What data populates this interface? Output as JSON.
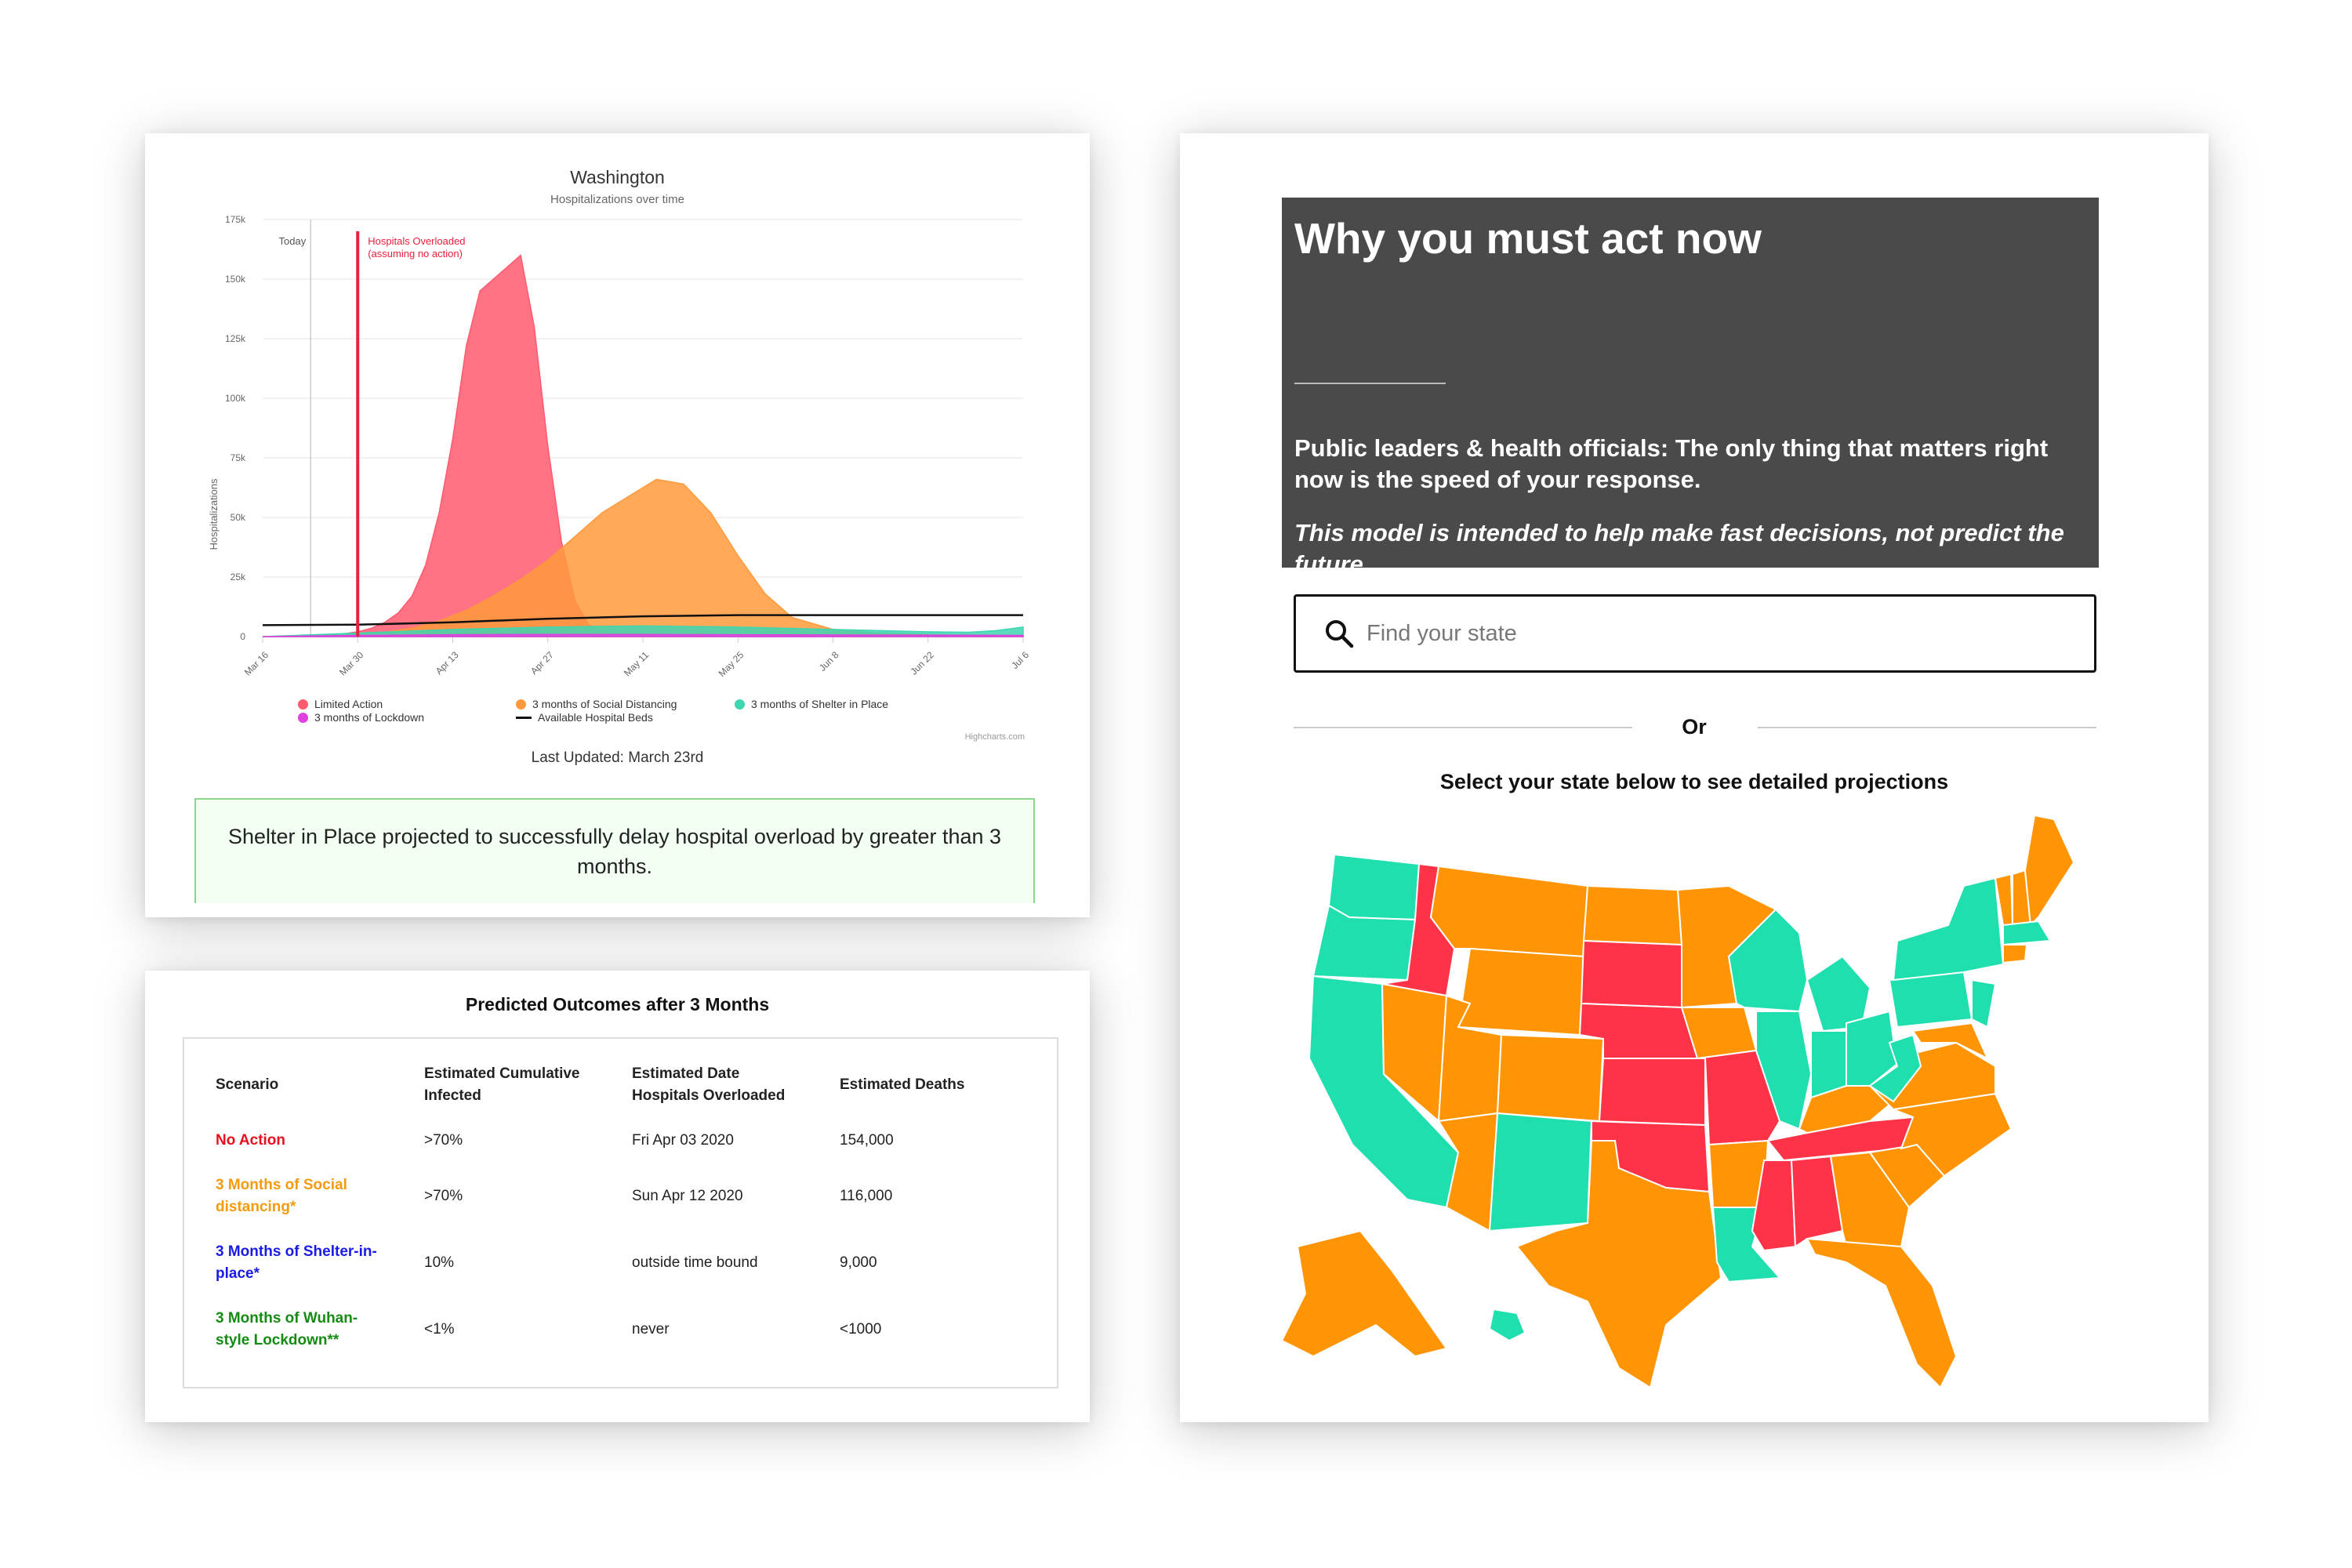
{
  "chart_panel": {
    "title": "Washington",
    "subtitle": "Hospitalizations over time",
    "today_label": "Today",
    "overload_label_1": "Hospitals Overloaded",
    "overload_label_2": "(assuming no action)",
    "credits": "Highcharts.com",
    "last_updated": "Last Updated: March 23rd",
    "notice": "Shelter in Place projected to successfully delay hospital overload by greater than 3 months."
  },
  "chart_data": {
    "type": "area",
    "title": "Washington",
    "subtitle": "Hospitalizations over time",
    "ylabel": "Hospitalizations",
    "ylim": [
      0,
      175000
    ],
    "ytick_labels": [
      "0",
      "25k",
      "50k",
      "75k",
      "100k",
      "125k",
      "150k",
      "175k"
    ],
    "xtick_labels": [
      "Mar 16",
      "Mar 30",
      "Apr 13",
      "Apr 27",
      "May 11",
      "May 25",
      "Jun 8",
      "Jun 22",
      "Jul 6"
    ],
    "x_days": [
      0,
      14,
      28,
      42,
      56,
      70,
      84,
      98,
      112
    ],
    "today_day": 14,
    "overload_day": 14,
    "legend_position": "bottom-left",
    "series": [
      {
        "name": "Limited Action",
        "color": "#ff5a6e",
        "x": [
          0,
          4,
          8,
          10,
          12,
          14,
          16,
          18,
          20,
          22,
          24,
          26,
          28,
          30,
          32,
          34,
          36,
          38,
          40,
          42,
          44,
          46,
          48,
          50,
          52,
          54,
          56,
          60,
          70,
          80,
          90,
          100,
          112
        ],
        "y": [
          0,
          200,
          500,
          800,
          1200,
          2000,
          3500,
          6000,
          10000,
          17000,
          30000,
          52000,
          83000,
          122000,
          145000,
          150000,
          155000,
          160000,
          130000,
          80000,
          40000,
          15000,
          5000,
          2000,
          1000,
          500,
          300,
          200,
          100,
          100,
          100,
          100,
          100
        ]
      },
      {
        "name": "3 months of Social Distancing",
        "color": "#ff9a3c",
        "x": [
          0,
          10,
          14,
          18,
          22,
          26,
          30,
          34,
          38,
          42,
          46,
          50,
          54,
          58,
          62,
          66,
          70,
          74,
          78,
          84,
          90,
          100,
          112
        ],
        "y": [
          0,
          300,
          800,
          1800,
          3500,
          6500,
          11000,
          17000,
          24000,
          32000,
          42000,
          52000,
          59000,
          66000,
          64000,
          52000,
          34000,
          18000,
          8000,
          3000,
          1500,
          800,
          500
        ]
      },
      {
        "name": "3 months of Shelter in Place",
        "color": "#3dd6b0",
        "x": [
          0,
          14,
          28,
          42,
          56,
          70,
          84,
          98,
          104,
          108,
          112
        ],
        "y": [
          0,
          1500,
          3000,
          4000,
          4500,
          4000,
          3000,
          2000,
          1800,
          2500,
          4000
        ]
      },
      {
        "name": "3 months of Lockdown",
        "color": "#e040e0",
        "x": [
          0,
          14,
          28,
          42,
          56,
          70,
          84,
          98,
          112
        ],
        "y": [
          0,
          500,
          800,
          900,
          900,
          800,
          700,
          600,
          500
        ]
      },
      {
        "name": "Available Hospital Beds",
        "color": "#111111",
        "line_only": true,
        "x": [
          0,
          14,
          28,
          42,
          56,
          70,
          84,
          98,
          112
        ],
        "y": [
          4800,
          5000,
          6000,
          7500,
          8500,
          9000,
          9000,
          9000,
          9000
        ]
      }
    ]
  },
  "table_panel": {
    "title": "Predicted Outcomes after 3 Months",
    "headers": {
      "scenario": "Scenario",
      "infected_1": "Estimated Cumulative",
      "infected_2": "Infected",
      "overload_1": "Estimated Date",
      "overload_2": "Hospitals Overloaded",
      "deaths": "Estimated Deaths"
    },
    "rows": [
      {
        "scenario_1": "No Action",
        "scenario_2": "",
        "color": "#e8101e",
        "infected": ">70%",
        "overload": "Fri Apr 03 2020",
        "deaths": "154,000"
      },
      {
        "scenario_1": "3 Months of Social",
        "scenario_2": "distancing*",
        "color": "#f39a0e",
        "infected": ">70%",
        "overload": "Sun Apr 12 2020",
        "deaths": "116,000"
      },
      {
        "scenario_1": "3 Months of Shelter-in-",
        "scenario_2": "place*",
        "color": "#1a1ae6",
        "infected": "10%",
        "overload": "outside time bound",
        "deaths": "9,000"
      },
      {
        "scenario_1": "3 Months of Wuhan-",
        "scenario_2": "style Lockdown**",
        "color": "#148c14",
        "infected": "<1%",
        "overload": "never",
        "deaths": "<1000"
      }
    ]
  },
  "right_panel": {
    "heading": "Why you must act now",
    "para1": "Public leaders & health officials: The only thing that matters right now is the speed of your response.",
    "para2": "This model is intended to help make fast decisions, not predict the future.",
    "search_placeholder": "Find your state",
    "or_label": "Or",
    "select_prompt": "Select your state below to see detailed projections",
    "map_colors": {
      "red": "#ff3347",
      "orange": "#ff9505",
      "green": "#1fdfaf"
    }
  }
}
